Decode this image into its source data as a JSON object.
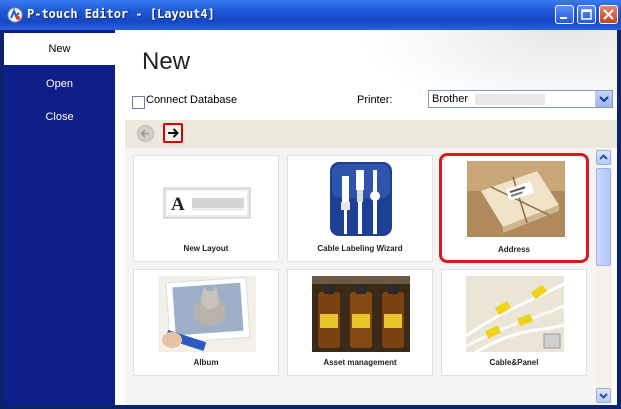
{
  "window": {
    "title": "P-touch Editor - [Layout4]",
    "icon": "p-touch-app-icon",
    "buttons": [
      "minimize-icon",
      "maximize-icon",
      "close-icon"
    ]
  },
  "sidebar": {
    "items": [
      {
        "label": "New",
        "active": true
      },
      {
        "label": "Open",
        "active": false
      },
      {
        "label": "Close",
        "active": false
      }
    ]
  },
  "main": {
    "title": "New",
    "connect_db_label": "Connect Database",
    "connect_db_checked": false,
    "printer_label": "Printer:",
    "printer_value": "Brother"
  },
  "nav": {
    "back_icon": "back-arrow-icon",
    "forward_icon": "forward-arrow-icon"
  },
  "templates": [
    {
      "label": "New Layout",
      "icon": "new-layout-icon",
      "selected": false
    },
    {
      "label": "Cable Labeling Wizard",
      "icon": "cable-wizard-icon",
      "selected": false
    },
    {
      "label": "Address",
      "icon": "address-package-icon",
      "selected": true
    },
    {
      "label": "Album",
      "icon": "album-cat-photo-icon",
      "selected": false
    },
    {
      "label": "Asset management",
      "icon": "asset-bottles-icon",
      "selected": false
    },
    {
      "label": "Cable&Panel",
      "icon": "cable-panel-icon",
      "selected": false
    }
  ],
  "colors": {
    "titlebar": "#1f5ad8",
    "sidebar": "#0f1f8a",
    "highlight": "#d81a1a"
  }
}
